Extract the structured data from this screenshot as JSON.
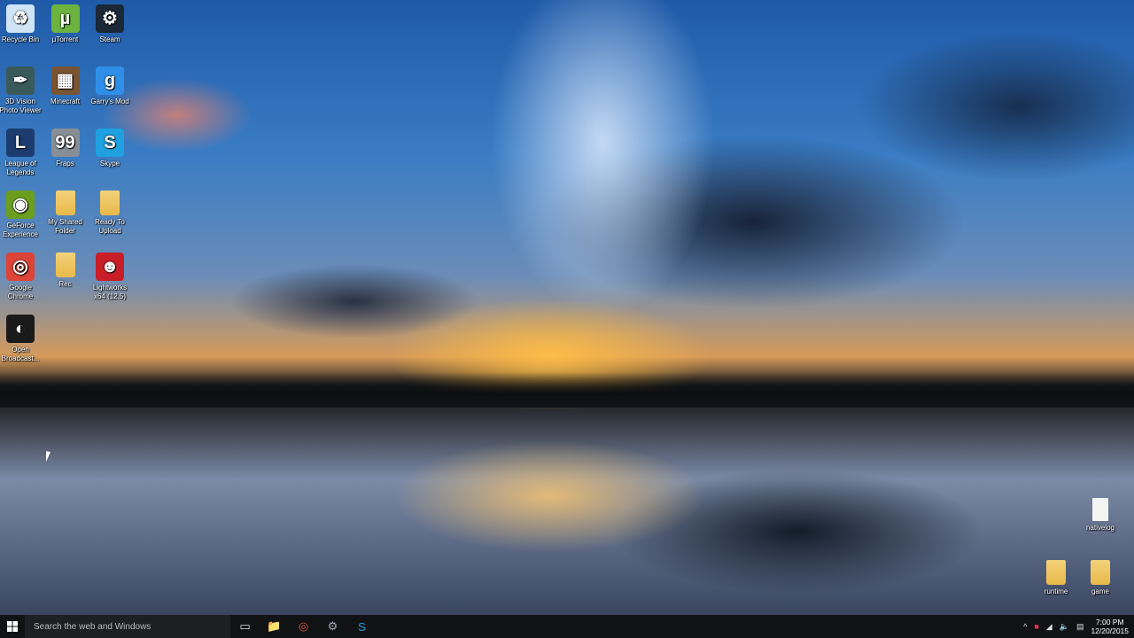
{
  "desktop": {
    "left_icons": [
      {
        "label": "Recycle Bin",
        "icon": "recycle-bin-icon",
        "color": "#cfe4f5",
        "glyph": "♻"
      },
      {
        "label": "µTorrent",
        "icon": "utorrent-icon",
        "color": "#6cb33f",
        "glyph": "µ"
      },
      {
        "label": "Steam",
        "icon": "steam-icon",
        "color": "#1b2838",
        "glyph": "⚙"
      },
      {
        "label": "3D Vision Photo Viewer",
        "icon": "3d-vision-icon",
        "color": "#3a5a5a",
        "glyph": "✒"
      },
      {
        "label": "Minecraft",
        "icon": "minecraft-icon",
        "color": "#7a5430",
        "glyph": "▦"
      },
      {
        "label": "Garry's Mod",
        "icon": "garrys-mod-icon",
        "color": "#2f8fe8",
        "glyph": "g"
      },
      {
        "label": "League of Legends",
        "icon": "league-of-legends-icon",
        "color": "#1c3c70",
        "glyph": "L"
      },
      {
        "label": "Fraps",
        "icon": "fraps-icon",
        "color": "#888e96",
        "glyph": "99"
      },
      {
        "label": "Skype",
        "icon": "skype-icon",
        "color": "#1fa0e0",
        "glyph": "S"
      },
      {
        "label": "GeForce Experience",
        "icon": "geforce-icon",
        "color": "#6b9e1f",
        "glyph": "◉"
      },
      {
        "label": "My Shared Folder",
        "icon": "folder-icon",
        "color": "folder",
        "glyph": ""
      },
      {
        "label": "Ready To Upload",
        "icon": "folder-icon",
        "color": "folder",
        "glyph": ""
      },
      {
        "label": "Google Chrome",
        "icon": "chrome-icon",
        "color": "#db4437",
        "glyph": "◎"
      },
      {
        "label": "Rec",
        "icon": "folder-icon",
        "color": "folder",
        "glyph": ""
      },
      {
        "label": "Lightworks x64 (12.5)",
        "icon": "lightworks-icon",
        "color": "#c81e28",
        "glyph": "☻"
      },
      {
        "label": "Open Broadcast...",
        "icon": "obs-icon",
        "color": "#1a1a1a",
        "glyph": "◐"
      }
    ],
    "right_icons": [
      {
        "label": "nativelog",
        "icon": "file-icon"
      },
      {
        "label": "runtime",
        "icon": "folder-icon"
      },
      {
        "label": "game",
        "icon": "folder-icon"
      }
    ]
  },
  "taskbar": {
    "search_placeholder": "Search the web and Windows",
    "pinned": [
      {
        "name": "task-view",
        "glyph": "▭"
      },
      {
        "name": "file-explorer",
        "glyph": "📁"
      },
      {
        "name": "chrome",
        "glyph": "◎"
      },
      {
        "name": "steam",
        "glyph": "⚙"
      },
      {
        "name": "skype",
        "glyph": "S"
      }
    ],
    "time": "7:00 PM",
    "date": "12/20/2015"
  }
}
